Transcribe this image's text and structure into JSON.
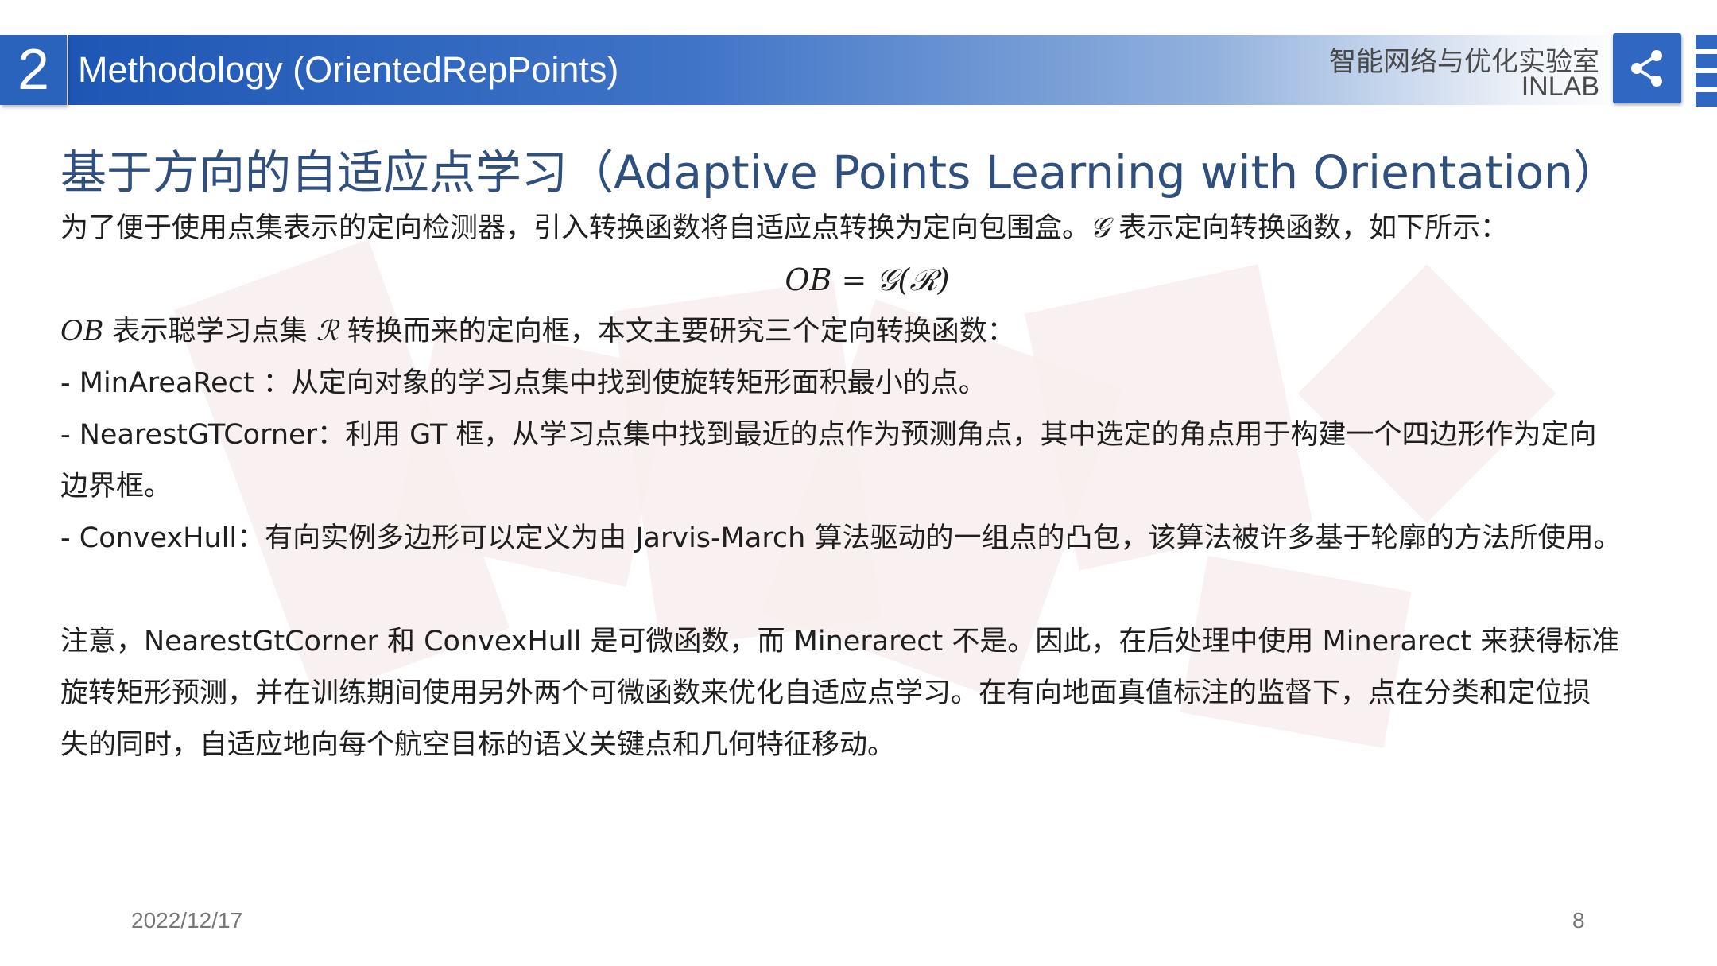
{
  "header": {
    "section_number": "2",
    "title": "Methodology (OrientedRepPoints)",
    "lab_name_cn": "智能网络与优化实验室",
    "lab_name_en": "INLAB"
  },
  "main": {
    "subtitle": "基于方向的自适应点学习（Adaptive Points Learning with Orientation）",
    "intro": {
      "before": "为了便于使用点集表示的定向检测器，引入转换函数将自适应点转换为定向包围盒。",
      "symbol": "𝒢",
      "after": " 表示定向转换函数，如下所示："
    },
    "formula": "𝑂𝐵 = 𝒢(ℛ)",
    "ob_line": {
      "sym1": "𝑂𝐵",
      "text1": " 表示聪学习点集 ",
      "sym2": "ℛ",
      "text2": " 转换而来的定向框，本文主要研究三个定向转换函数："
    },
    "bullets": {
      "minarearect": "- MinAreaRect ：从定向对象的学习点集中找到使旋转矩形面积最小的点。",
      "nearest_line1": "-  NearestGTCorner：利用 GT 框，从学习点集中找到最近的点作为预测角点，其中选定的角点用于构建一个四边形作为定向",
      "nearest_line2": "边界框。",
      "convexhull": "-  ConvexHull：有向实例多边形可以定义为由 Jarvis-March 算法驱动的一组点的凸包，该算法被许多基于轮廓的方法所使用。"
    },
    "note": {
      "line1": "注意，NearestGtCorner 和 ConvexHull 是可微函数，而 Minerarect 不是。因此，在后处理中使用 Minerarect 来获得标准",
      "line2": "旋转矩形预测，并在训练期间使用另外两个可微函数来优化自适应点学习。在有向地面真值标注的监督下，点在分类和定位损",
      "line3": "失的同时，自适应地向每个航空目标的语义关键点和几何特征移动。"
    }
  },
  "footer": {
    "date": "2022/12/17",
    "page_number": "8"
  },
  "icons": {
    "share": "share-icon"
  },
  "colors": {
    "header_blue": "#2a63bc",
    "subtitle": "#2f4f7f"
  }
}
